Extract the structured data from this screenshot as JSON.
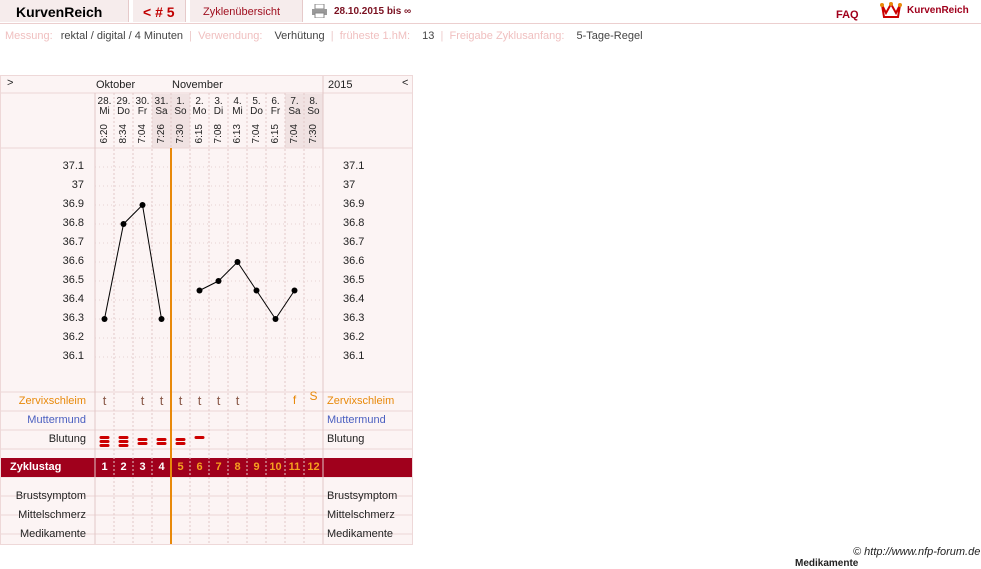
{
  "header": {
    "brand": "KurvenReich",
    "cycle": "< # 5",
    "overview": "Zyklenübersicht",
    "daterange": "28.10.2015 bis ∞",
    "faq": "FAQ",
    "logo_text": "KurvenReich"
  },
  "meta": {
    "messung_label": "Messung:",
    "messung": "rektal / digital / 4 Minuten",
    "verwendung_label": "Verwendung:",
    "verwendung": "Verhütung",
    "hm_label": "früheste 1.hM:",
    "hm": "13",
    "freigabe_label": "Freigabe Zyklusanfang:",
    "freigabe": "5-Tage-Regel"
  },
  "nav": {
    "prev": ">",
    "next": "<",
    "year": "2015"
  },
  "months": [
    "Oktober",
    "November"
  ],
  "days": [
    {
      "d": "28.",
      "wd": "Mi",
      "t": "6:20",
      "we": false
    },
    {
      "d": "29.",
      "wd": "Do",
      "t": "8:34",
      "we": false
    },
    {
      "d": "30.",
      "wd": "Fr",
      "t": "7:04",
      "we": false
    },
    {
      "d": "31.",
      "wd": "Sa",
      "t": "7:26",
      "we": true
    },
    {
      "d": "1.",
      "wd": "So",
      "t": "7:30",
      "we": true
    },
    {
      "d": "2.",
      "wd": "Mo",
      "t": "6:15",
      "we": false
    },
    {
      "d": "3.",
      "wd": "Di",
      "t": "7:08",
      "we": false
    },
    {
      "d": "4.",
      "wd": "Mi",
      "t": "6:13",
      "we": false
    },
    {
      "d": "5.",
      "wd": "Do",
      "t": "7:04",
      "we": false
    },
    {
      "d": "6.",
      "wd": "Fr",
      "t": "6:15",
      "we": false
    },
    {
      "d": "7.",
      "wd": "Sa",
      "t": "7:04",
      "we": true
    },
    {
      "d": "8.",
      "wd": "So",
      "t": "7:30",
      "we": true
    }
  ],
  "yticks": [
    "37.1",
    "37",
    "36.9",
    "36.8",
    "36.7",
    "36.6",
    "36.5",
    "36.4",
    "36.3",
    "36.2",
    "36.1"
  ],
  "temps": [
    36.3,
    36.8,
    36.9,
    36.3,
    null,
    36.45,
    36.5,
    36.6,
    36.45,
    36.3,
    36.45,
    null
  ],
  "labels": {
    "zervix": "Zervixschleim",
    "muttermund": "Muttermund",
    "blutung": "Blutung",
    "zyklustag": "Zyklustag",
    "brust": "Brustsymptom",
    "mittel": "Mittelschmerz",
    "medi": "Medikamente"
  },
  "zervix": [
    "t",
    "",
    "t",
    "t",
    "t",
    "t",
    "t",
    "t",
    "",
    "",
    "f",
    "S"
  ],
  "blutung": [
    3,
    3,
    2,
    2,
    2,
    1,
    0,
    0,
    0,
    0,
    0,
    0
  ],
  "zyklustage": [
    "1",
    "2",
    "3",
    "4",
    "5",
    "6",
    "7",
    "8",
    "9",
    "10",
    "11",
    "12"
  ],
  "footer": {
    "copyright": "© http://www.nfp-forum.de",
    "medi_cut": "Medikamente"
  },
  "colors": {
    "accent": "#a0001c",
    "orange": "#e8890a",
    "blue": "#4a5fc0",
    "blood": "#cc0000"
  }
}
